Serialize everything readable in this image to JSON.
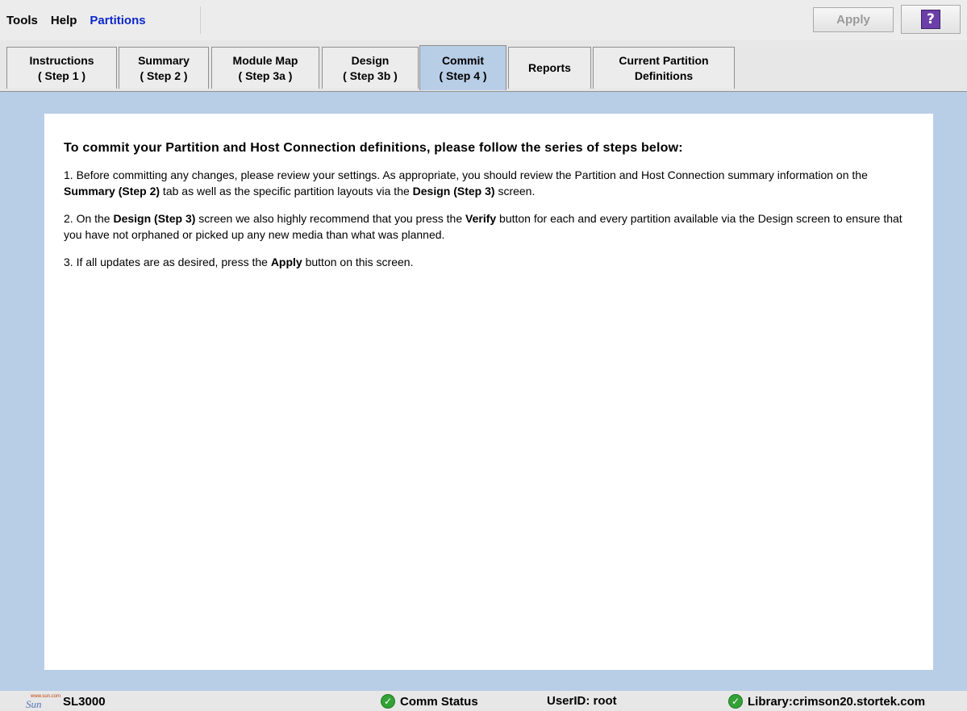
{
  "menu": {
    "tools": "Tools",
    "help": "Help",
    "partitions": "Partitions"
  },
  "toolbar": {
    "apply_label": "Apply",
    "help_icon_glyph": "?"
  },
  "tabs": [
    {
      "line1": "Instructions",
      "line2": "( Step 1 )"
    },
    {
      "line1": "Summary",
      "line2": "( Step 2 )"
    },
    {
      "line1": "Module Map",
      "line2": "( Step 3a )"
    },
    {
      "line1": "Design",
      "line2": "( Step 3b )"
    },
    {
      "line1": "Commit",
      "line2": "( Step 4 )"
    },
    {
      "line1": "Reports",
      "line2": ""
    },
    {
      "line1": "Current Partition",
      "line2": "Definitions"
    }
  ],
  "selected_tab": "Commit",
  "content": {
    "heading": "To commit your Partition and Host Connection definitions, please follow the series of steps below:",
    "step1": {
      "a": "1.  Before committing any changes, please review your settings.  As appropriate, you should review the Partition and Host Connection summary information on the ",
      "b1": "Summary (Step 2)",
      "c": " tab as well as the specific partition layouts via the ",
      "b2": "Design (Step 3)",
      "d": " screen."
    },
    "step2": {
      "a": "2.  On the ",
      "b1": "Design (Step 3)",
      "c": " screen we also highly recommend that you press the ",
      "b2": "Verify",
      "d": " button for each and every partition available via the Design screen to ensure that you have not orphaned or picked up any new media than what was planned."
    },
    "step3": {
      "a": "3.  If all updates are as desired, press the ",
      "b1": "Apply",
      "c": " button on this screen."
    }
  },
  "status": {
    "logo_small": "www.sun.com",
    "logo_word": "Sun",
    "product": "SL3000",
    "comm": "Comm Status",
    "user": "UserID: root",
    "library": "Library:crimson20.stortek.com"
  },
  "colors": {
    "accent": "#0d28c9",
    "tab_selected": "#b8cde6",
    "status_ok": "#33a236"
  }
}
